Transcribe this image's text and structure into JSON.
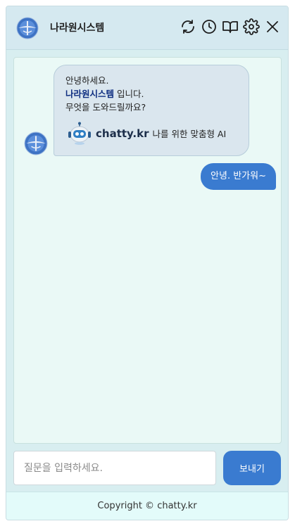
{
  "header": {
    "title": "나라원시스템",
    "icons": [
      "refresh-icon",
      "history-icon",
      "book-icon",
      "gear-icon",
      "close-icon"
    ]
  },
  "messages": {
    "bot": {
      "line1": "안녕하세요.",
      "brand": "나라원시스템",
      "line2_suffix": " 입니다.",
      "line3": "무엇을 도와드릴까요?",
      "chatty_brand": "chatty.kr",
      "chatty_tagline": "나를 위한 맞춤형 AI"
    },
    "user": {
      "text": "안녕. 반가워~"
    }
  },
  "composer": {
    "placeholder": "질문을 입력하세요.",
    "send_label": "보내기"
  },
  "footer": {
    "copyright": "Copyright © chatty.kr"
  },
  "colors": {
    "accent": "#3a7bd0",
    "brand_text": "#0d2d80",
    "bot_bubble": "#dae6ee",
    "chat_bg": "#eaf9f6"
  }
}
